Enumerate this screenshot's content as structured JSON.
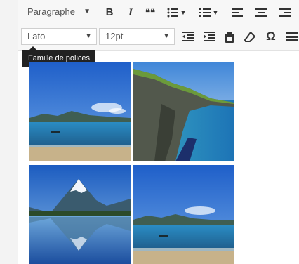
{
  "toolbar": {
    "format_select": {
      "value": "Paragraphe"
    },
    "font_select": {
      "value": "Lato"
    },
    "size_select": {
      "value": "12pt"
    },
    "buttons": {
      "bold": "B",
      "italic": "I",
      "quote": "❝❝",
      "special_char": "Ω"
    }
  },
  "tooltip": {
    "text": "Famille de polices"
  },
  "gallery": {
    "images": [
      {
        "subject": "lake-with-mountains"
      },
      {
        "subject": "coastal-cliffs"
      },
      {
        "subject": "mountain-reflection"
      },
      {
        "subject": "lake-with-mountains"
      }
    ]
  },
  "colors": {
    "toolbar_bg": "#f7f7f7",
    "tooltip_bg": "#222222",
    "sky": "#2f6fd0",
    "water": "#1e6fa8"
  }
}
